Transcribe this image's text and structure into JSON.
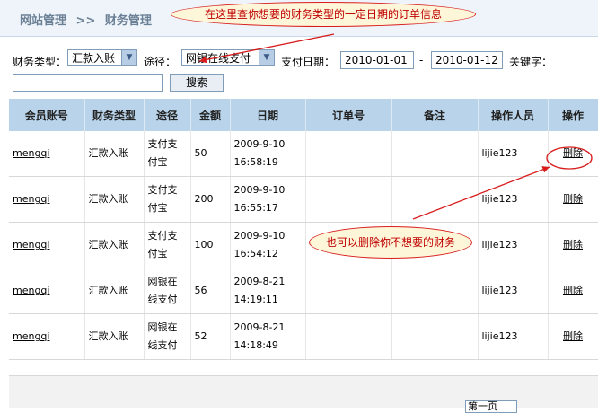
{
  "breadcrumb": {
    "site": "网站管理",
    "sep": ">>",
    "current": "财务管理"
  },
  "annotations": {
    "top": "在这里查你想要的财务类型的一定日期的订单信息",
    "delete": "也可以删除你不想要的财务"
  },
  "filters": {
    "type_label": "财务类型：",
    "type_value": "汇款入账",
    "path_label": "途径：",
    "path_value": "网银在线支付",
    "date_label": "支付日期：",
    "date_from": "2010-01-01",
    "date_sep": "-",
    "date_to": "2010-01-12",
    "keyword_label": "关键字：",
    "keyword_value": "",
    "search_button": "搜索"
  },
  "table": {
    "headers": [
      "会员账号",
      "财务类型",
      "途径",
      "金额",
      "日期",
      "订单号",
      "备注",
      "操作人员",
      "操作"
    ],
    "rows": [
      {
        "user": "mengqi",
        "type": "汇款入账",
        "path1": "支付支",
        "path2": "付宝",
        "amount": "50",
        "date1": "2009-9-10",
        "date2": "16:58:19",
        "order": "",
        "note": "",
        "operator": "lijie123",
        "action": "删除"
      },
      {
        "user": "mengqi",
        "type": "汇款入账",
        "path1": "支付支",
        "path2": "付宝",
        "amount": "200",
        "date1": "2009-9-10",
        "date2": "16:55:17",
        "order": "",
        "note": "",
        "operator": "lijie123",
        "action": "删除"
      },
      {
        "user": "mengqi",
        "type": "汇款入账",
        "path1": "支付支",
        "path2": "付宝",
        "amount": "100",
        "date1": "2009-9-10",
        "date2": "16:54:12",
        "order": "",
        "note": "",
        "operator": "lijie123",
        "action": "删除"
      },
      {
        "user": "mengqi",
        "type": "汇款入账",
        "path1": "网银在",
        "path2": "线支付",
        "amount": "56",
        "date1": "2009-8-21",
        "date2": "14:19:11",
        "order": "",
        "note": "",
        "operator": "lijie123",
        "action": "删除"
      },
      {
        "user": "mengqi",
        "type": "汇款入账",
        "path1": "网银在",
        "path2": "线支付",
        "amount": "52",
        "date1": "2009-8-21",
        "date2": "14:18:49",
        "order": "",
        "note": "",
        "operator": "lijie123",
        "action": "删除"
      }
    ]
  },
  "pager": {
    "label": "第一页"
  },
  "colors": {
    "header_bg": "#b9d4ea",
    "annotation": "#d81c1c",
    "note_bg": "#fdf6d8"
  },
  "icons": {
    "dropdown": "chevron-down-icon"
  }
}
